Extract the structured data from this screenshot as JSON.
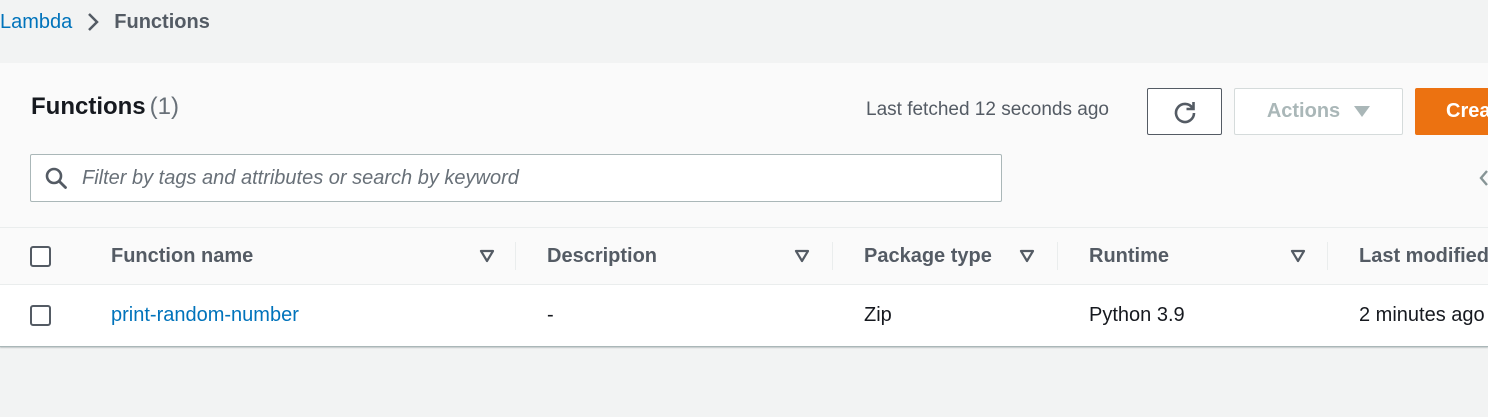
{
  "breadcrumb": {
    "items": [
      {
        "label": "Lambda"
      },
      {
        "label": "Functions"
      }
    ],
    "separator_icon": "chevron-right-icon"
  },
  "panel": {
    "title": "Functions",
    "count": "(1)",
    "last_fetched": "Last fetched 12 seconds ago",
    "refresh_icon": "refresh-icon",
    "actions_label": "Actions",
    "create_label": "Create function",
    "search": {
      "placeholder": "Filter by tags and attributes or search by keyword",
      "value": ""
    }
  },
  "table": {
    "columns": [
      {
        "label": "Function name"
      },
      {
        "label": "Description"
      },
      {
        "label": "Package type"
      },
      {
        "label": "Runtime"
      },
      {
        "label": "Last modified"
      }
    ],
    "rows": [
      {
        "function_name": "print-random-number",
        "description": "-",
        "package_type": "Zip",
        "runtime": "Python 3.9",
        "last_modified": "2 minutes ago"
      }
    ]
  },
  "colors": {
    "link": "#0073bb",
    "primary_button": "#ec7211",
    "background": "#f2f3f3",
    "heading_text": "#545b64"
  }
}
